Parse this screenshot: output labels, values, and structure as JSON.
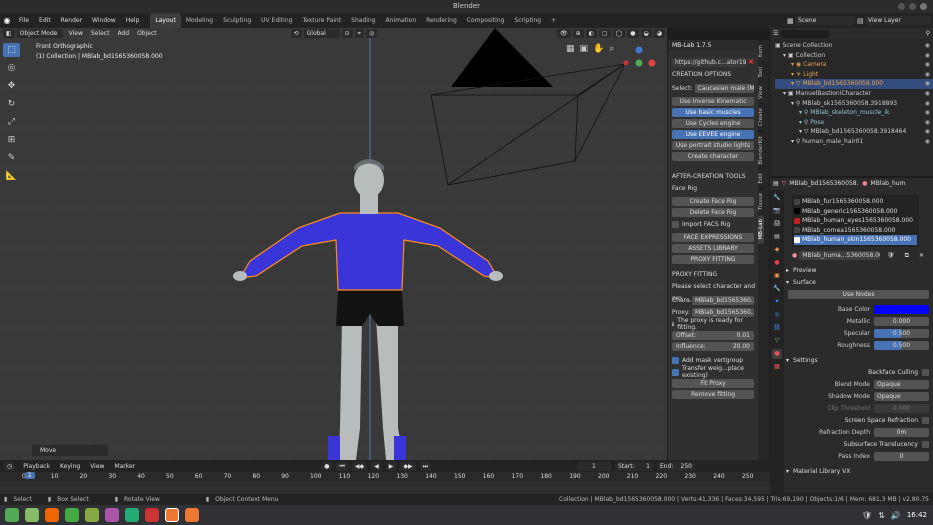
{
  "window": {
    "title": "Blender"
  },
  "menubar": {
    "menus": [
      "File",
      "Edit",
      "Render",
      "Window",
      "Help"
    ],
    "workspaces": [
      "Layout",
      "Modeling",
      "Sculpting",
      "UV Editing",
      "Texture Paint",
      "Shading",
      "Animation",
      "Rendering",
      "Compositing",
      "Scripting"
    ],
    "active_workspace": "Layout",
    "add_tab": "+",
    "scene_label": "Scene",
    "view_layer_label": "View Layer"
  },
  "viewport": {
    "mode": "Object Mode",
    "menus": [
      "View",
      "Select",
      "Add",
      "Object"
    ],
    "orientation": "Global",
    "view_name": "Front Orthographic",
    "collection_info": "(1) Collection | MBlab_bd1565360058.000",
    "last_op": "Move",
    "colors": {
      "shirt": "#3a35d9",
      "shorts": "#121212",
      "skin": "#b8bcbd",
      "selection": "#ff8c1a"
    }
  },
  "npanel": {
    "title": "MB-Lab 1.7.5",
    "url": "https://github.c...ator1978/MB-Lab",
    "creation_header": "CREATION OPTIONS",
    "select_label": "Select:",
    "select_value": "Caucasian male (M...",
    "buttons": {
      "inverse_kin": "Use Inverse Kinematic",
      "basic_muscles": "Use basic muscles",
      "cycles": "Use Cycles engine",
      "eevee": "Use EEVEE engine",
      "portrait": "Use portrait studio lights",
      "create": "Create character"
    },
    "after_header": "AFTER-CREATION TOOLS",
    "face_rig": "Face Rig",
    "create_face_rig": "Create Face Rig",
    "delete_face_rig": "Delete Face Rig",
    "import_facs": "Import FACS Rig",
    "face_expr": "FACE EXPRESSIONS",
    "assets": "ASSETS LIBRARY",
    "proxy_fitting_btn": "PROXY FITTING",
    "proxy_header": "PROXY FITTING",
    "proxy_msg": "Please select character and pro...",
    "chara_label": "Chara...",
    "chara_value": "MBlab_bd1565360...",
    "proxy_label": "Proxy:",
    "proxy_value": "MBlab_bd1565360...",
    "ready_msg": "The proxy is ready for fitting.",
    "offset_label": "Offset:",
    "offset_value": "0.01",
    "influence_label": "Influence:",
    "influence_value": "20.00",
    "add_mask": "Add mask vertgroup",
    "transfer": "Transfer weig...place existing)",
    "fit_proxy": "Fit Proxy",
    "remove_fitting": "Remove fitting"
  },
  "vtabs": [
    "Item",
    "Tool",
    "View",
    "Create",
    "BlenderKit",
    "Edit",
    "Tissue",
    "MB-Lab"
  ],
  "outliner": {
    "rows": [
      {
        "label": "Scene Collection",
        "indent": 0,
        "color": "#cccccc"
      },
      {
        "label": "Collection",
        "indent": 1,
        "color": "#cccccc"
      },
      {
        "label": "Camera",
        "indent": 2,
        "color": "#e6a04d"
      },
      {
        "label": "Light",
        "indent": 2,
        "color": "#e6a04d"
      },
      {
        "label": "MBlab_bd1565360058.000",
        "indent": 2,
        "color": "#f0a040"
      },
      {
        "label": "ManuelBastioniCharacter",
        "indent": 1,
        "color": "#cccccc"
      },
      {
        "label": "MBlab_sk1565360058.3918893",
        "indent": 2,
        "color": "#cccccc"
      },
      {
        "label": "MBlab_skeleton_muscle_ik",
        "indent": 3,
        "color": "#8fc7d6"
      },
      {
        "label": "Pose",
        "indent": 3,
        "color": "#8fc7d6"
      },
      {
        "label": "MBlab_bd1565360058.3918464",
        "indent": 3,
        "color": "#cccccc"
      },
      {
        "label": "human_male_hair01",
        "indent": 2,
        "color": "#cccccc"
      }
    ]
  },
  "properties": {
    "object_name": "MBlab_bd1565360058.000",
    "tab_name": "MBlab_hum",
    "material_slots": [
      "MBlab_fur1565360058.000",
      "MBlab_generic1565360058.000",
      "MBlab_human_eyes1565360058.000",
      "MBlab_cornea1565360058.000",
      "MBlab_human_skin1565360058.000"
    ],
    "active_slot": "MBlab_human_skin1565360058.000",
    "material_name": "MBlab_huma...5360058.000",
    "preview": "Preview",
    "surface": "Surface",
    "use_nodes": "Use Nodes",
    "base_color_label": "Base Color",
    "base_color": "#0000ff",
    "metallic_label": "Metallic",
    "metallic": "0.000",
    "specular_label": "Specular",
    "specular": "0.500",
    "roughness_label": "Roughness",
    "roughness": "0.500",
    "settings": "Settings",
    "backface": "Backface Culling",
    "blend_label": "Blend Mode",
    "blend": "Opaque",
    "shadow_label": "Shadow Mode",
    "shadow": "Opaque",
    "clip_label": "Clip Threshold",
    "clip": "0.000",
    "ssr": "Screen Space Refraction",
    "refr_depth_label": "Refraction Depth",
    "refr_depth": "0m",
    "sss": "Subsurface Translucency",
    "pass_label": "Pass Index",
    "pass": "0",
    "mat_vx": "Material Library VX"
  },
  "timeline": {
    "menus": [
      "Playback",
      "Keying",
      "View",
      "Marker"
    ],
    "current_frame": "1",
    "start_label": "Start:",
    "start": "1",
    "end_label": "End:",
    "end": "250",
    "ticks": [
      "0",
      "10",
      "20",
      "30",
      "40",
      "50",
      "60",
      "70",
      "80",
      "90",
      "100",
      "110",
      "120",
      "130",
      "140",
      "150",
      "160",
      "170",
      "180",
      "190",
      "200",
      "210",
      "220",
      "230",
      "240",
      "250"
    ],
    "cursor_frame": "1"
  },
  "status": {
    "select": "Select",
    "box_select": "Box Select",
    "rotate_view": "Rotate View",
    "context_menu": "Object Context Menu",
    "info": "Collection | MBlab_bd1565360058.000 | Verts:41,336 | Faces:34,595 | Tris:69,190 | Objects:1/6 | Mem: 681.3 MB | v2.80.75"
  },
  "taskbar": {
    "clock": "16:42"
  }
}
